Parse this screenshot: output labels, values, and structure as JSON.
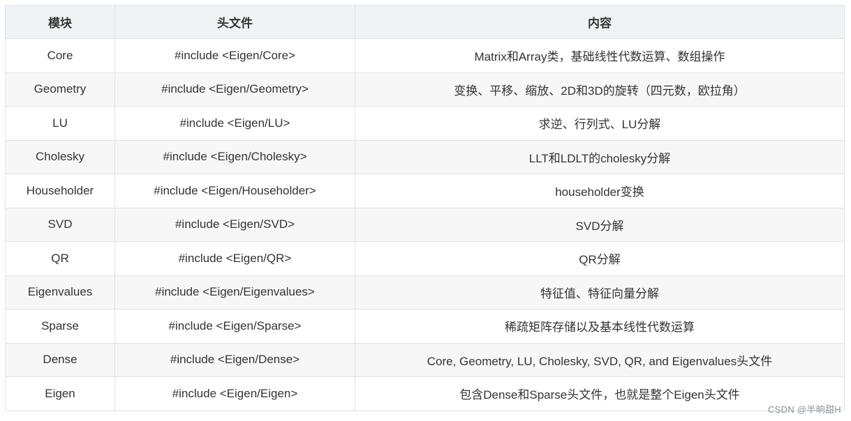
{
  "table": {
    "headers": [
      "模块",
      "头文件",
      "内容"
    ],
    "rows": [
      [
        "Core",
        "#include <Eigen/Core>",
        "Matrix和Array类，基础线性代数运算、数组操作"
      ],
      [
        "Geometry",
        "#include <Eigen/Geometry>",
        "变换、平移、缩放、2D和3D的旋转（四元数，欧拉角）"
      ],
      [
        "LU",
        "#include <Eigen/LU>",
        "求逆、行列式、LU分解"
      ],
      [
        "Cholesky",
        "#include <Eigen/Cholesky>",
        "LLT和LDLT的cholesky分解"
      ],
      [
        "Householder",
        "#include <Eigen/Householder>",
        "householder变换"
      ],
      [
        "SVD",
        "#include <Eigen/SVD>",
        "SVD分解"
      ],
      [
        "QR",
        "#include <Eigen/QR>",
        "QR分解"
      ],
      [
        "Eigenvalues",
        "#include <Eigen/Eigenvalues>",
        "特征值、特征向量分解"
      ],
      [
        "Sparse",
        "#include <Eigen/Sparse>",
        "稀疏矩阵存储以及基本线性代数运算"
      ],
      [
        "Dense",
        "#include <Eigen/Dense>",
        "Core, Geometry, LU, Cholesky, SVD, QR, and Eigenvalues头文件"
      ],
      [
        "Eigen",
        "#include <Eigen/Eigen>",
        "包含Dense和Sparse头文件，也就是整个Eigen头文件"
      ]
    ]
  },
  "watermark": "CSDN @半晌甜H",
  "colors": {
    "header_bg": "#eff3f5",
    "row_alt_bg": "#f7f7f7",
    "border": "#dfe2e5",
    "text": "#333333"
  }
}
